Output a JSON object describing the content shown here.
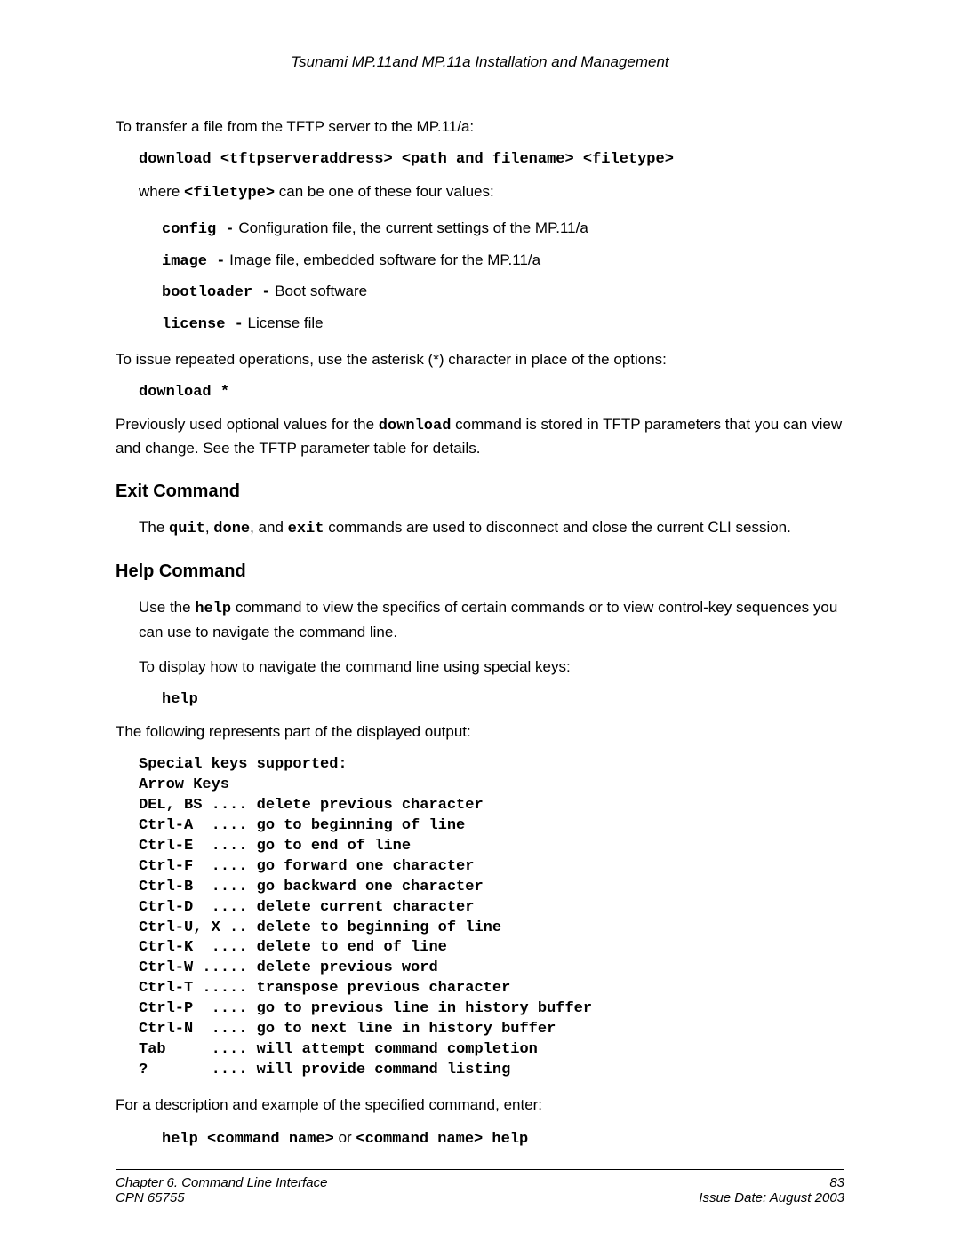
{
  "header": "Tsunami MP.11and MP.11a Installation and Management",
  "p1": "To transfer a file from the TFTP server to the MP.11/a:",
  "cmd1": "download <tftpserveraddress> <path and filename> <filetype>",
  "p2_prefix": "where ",
  "p2_mono": "<filetype>",
  "p2_suffix": " can be one of these four values:",
  "filetypes": {
    "config_cmd": "config -",
    "config_desc": "  Configuration file, the current settings of the MP.11/a",
    "image_cmd": "image -",
    "image_desc": "  Image file, embedded software for the MP.11/a",
    "bootloader_cmd": "bootloader -",
    "bootloader_desc": " Boot software",
    "license_cmd": "license -",
    "license_desc": "  License file"
  },
  "p3": "To issue repeated operations, use the asterisk (*) character in place of the options:",
  "cmd2": "download *",
  "p4_prefix": "Previously used optional values for the ",
  "p4_mono": "download",
  "p4_suffix": " command is stored in TFTP parameters that you can view and change.  See the TFTP parameter table for details.",
  "exit_heading": "Exit Command",
  "exit_p_prefix": "The ",
  "exit_quit": "quit",
  "exit_sep1": ", ",
  "exit_done": "done",
  "exit_sep2": ", and ",
  "exit_exit": "exit",
  "exit_p_suffix": " commands are used to disconnect and close the current CLI session.",
  "help_heading": "Help Command",
  "help_p1_prefix": "Use the ",
  "help_p1_mono": "help",
  "help_p1_suffix": " command to view the specifics of certain commands or to view control-key sequences you can use to navigate the command line.",
  "help_p2": "To display how to navigate the command line using special keys:",
  "cmd3": "help",
  "help_p3": "The following represents part of the displayed output:",
  "special_keys": "Special keys supported:\nArrow Keys\nDEL, BS .... delete previous character\nCtrl-A  .... go to beginning of line\nCtrl-E  .... go to end of line\nCtrl-F  .... go forward one character\nCtrl-B  .... go backward one character\nCtrl-D  .... delete current character\nCtrl-U, X .. delete to beginning of line\nCtrl-K  .... delete to end of line\nCtrl-W ..... delete previous word\nCtrl-T ..... transpose previous character\nCtrl-P  .... go to previous line in history buffer\nCtrl-N  .... go to next line in history buffer\nTab     .... will attempt command completion\n?       .... will provide command listing",
  "help_p4": "For a description and example of  the specified command, enter:",
  "cmd4_a": "help <command name>",
  "cmd4_or": " or ",
  "cmd4_b": "<command name> help",
  "footer": {
    "chapter": "Chapter 6.  Command Line Interface",
    "page": "83",
    "cpn": "CPN 65755",
    "issue": "Issue Date:  August 2003"
  }
}
